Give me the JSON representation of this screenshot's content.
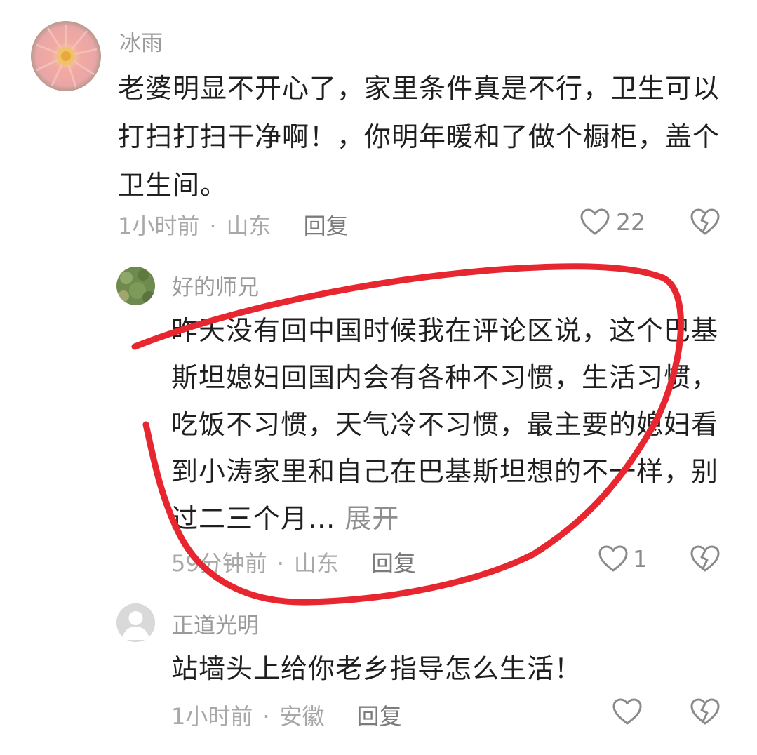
{
  "comments": [
    {
      "username": "冰雨",
      "text": "老婆明显不开心了，家里条件真是不行，卫生可以打扫打扫干净啊！，你明年暖和了做个橱柜，盖个卫生间。",
      "time": "1小时前",
      "location": "山东",
      "reply_label": "回复",
      "likes": "22",
      "avatar": "chrysanthemum-flower-avatar"
    },
    {
      "username": "好的师兄",
      "text": "昨天没有回中国时候我在评论区说，这个巴基斯坦媳妇回国内会有各种不习惯，生活习惯，吃饭不习惯，天气冷不习惯，最主要的媳妇看到小涛家里和自己在巴基斯坦想的不一样，别过二三个月...",
      "expand_label": "展开",
      "time": "59分钟前",
      "location": "山东",
      "reply_label": "回复",
      "likes": "1",
      "avatar": "green-grass-avatar"
    },
    {
      "username": "正道光明",
      "text": "站墙头上给你老乡指导怎么生活！",
      "time": "1小时前",
      "location": "安徽",
      "reply_label": "回复",
      "likes": "",
      "avatar": "default-user-avatar"
    }
  ],
  "separator": "·",
  "icons": {
    "like": "heart-outline-icon",
    "dislike": "broken-heart-icon"
  },
  "colors": {
    "annotation": "#e8262f",
    "meta": "#a8a8a8",
    "username": "#9a9a9a"
  }
}
